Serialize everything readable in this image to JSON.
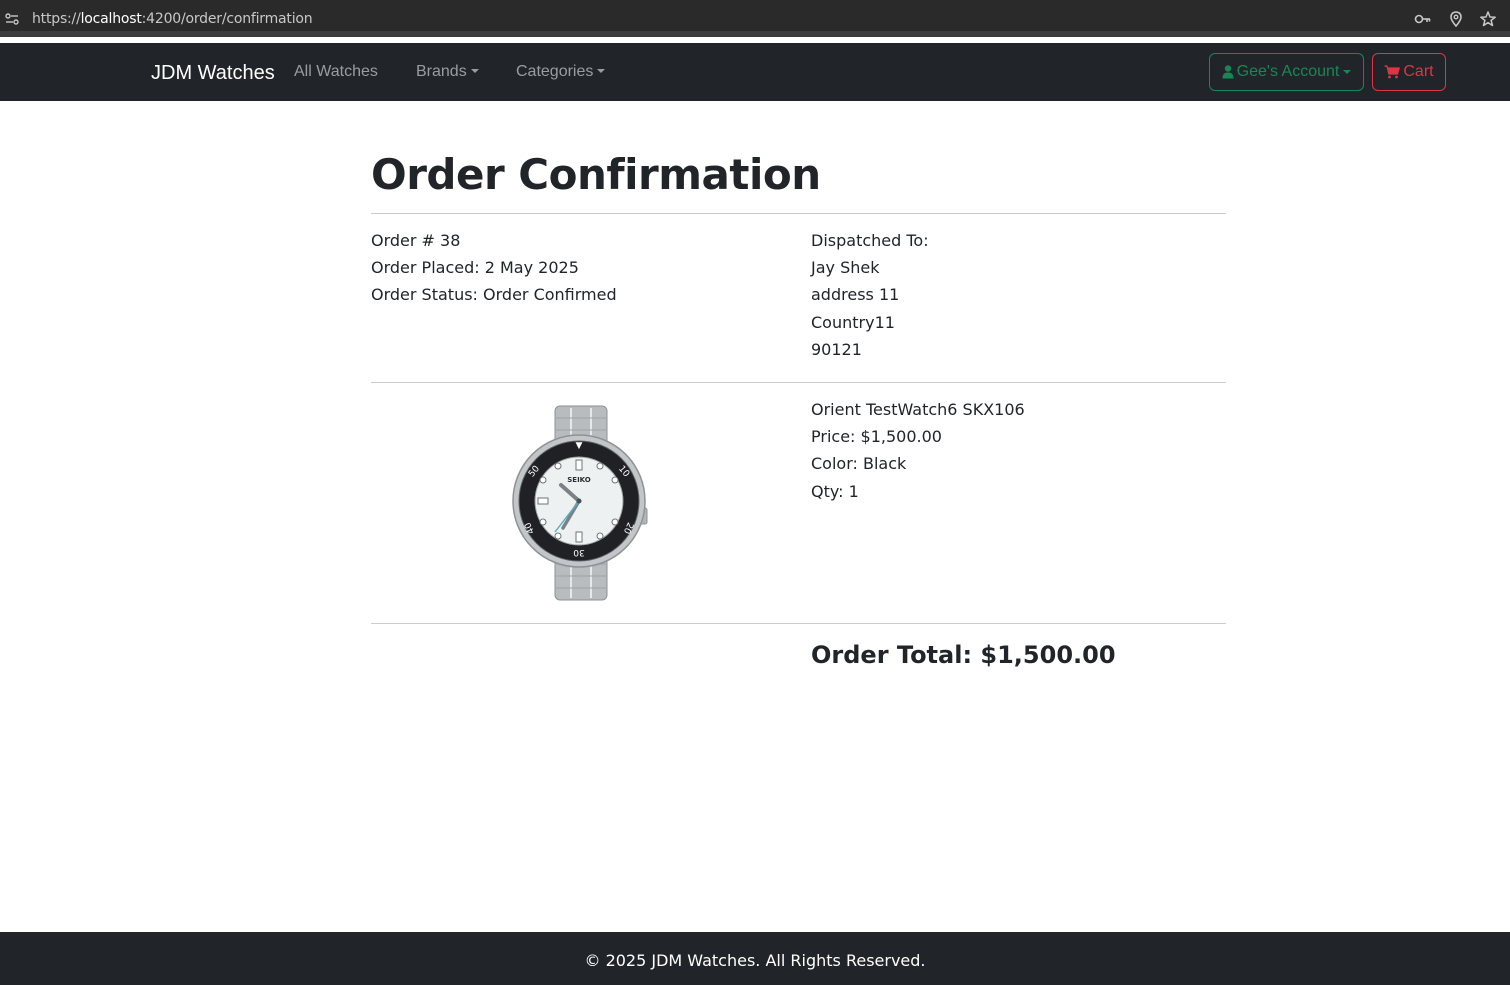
{
  "browser": {
    "url_prefix": "https://",
    "url_host": "localhost",
    "url_rest": ":4200/order/confirmation"
  },
  "navbar": {
    "brand": "JDM Watches",
    "links": [
      "All Watches",
      "Brands",
      "Categories"
    ],
    "account_label": "Gee's Account",
    "cart_label": "Cart",
    "colors": {
      "account": "#198754",
      "cart": "#dc3545"
    }
  },
  "page": {
    "title": "Order Confirmation"
  },
  "order": {
    "number_line": "Order # 38",
    "placed_line": "Order Placed: 2 May 2025",
    "status_line": "Order Status: Order Confirmed"
  },
  "dispatch": {
    "heading": "Dispatched To:",
    "name": "Jay Shek",
    "address": "address 11",
    "country": "Country11",
    "postcode": "90121"
  },
  "item": {
    "name": "Orient TestWatch6 SKX106",
    "price_line": "Price: $1,500.00",
    "color_line": "Color: Black",
    "qty_line": "Qty: 1",
    "image_brand": "SEIKO"
  },
  "summary": {
    "total_line": "Order Total: $1,500.00"
  },
  "footer": {
    "text": "© 2025 JDM Watches. All Rights Reserved."
  }
}
